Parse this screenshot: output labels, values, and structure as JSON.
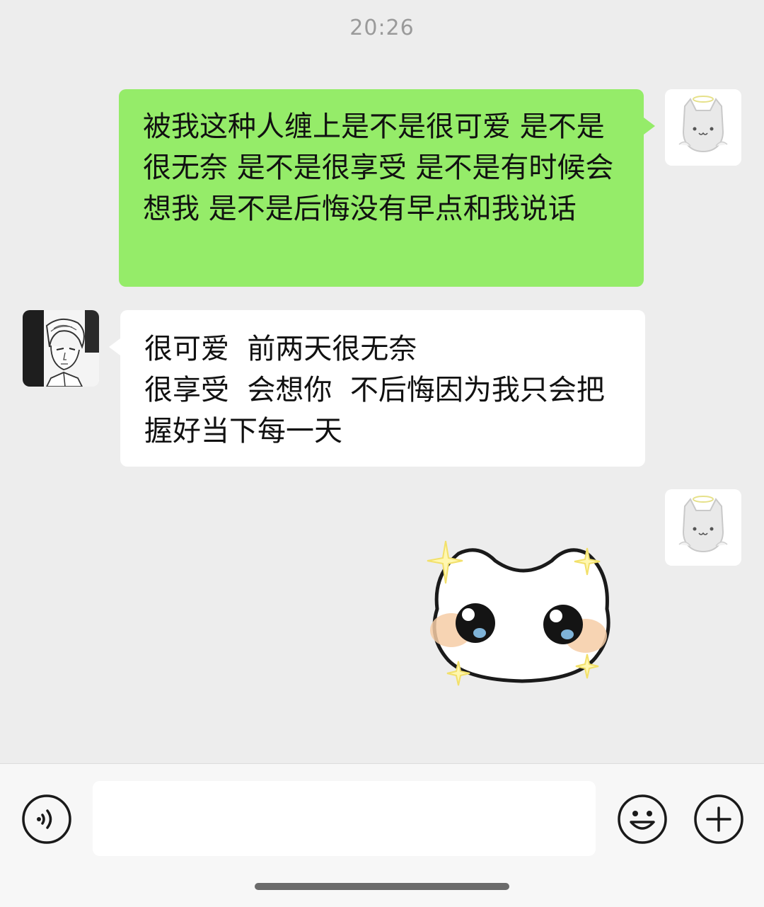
{
  "chat": {
    "timestamp": "20:26",
    "messages": [
      {
        "direction": "sent",
        "text": "被我这种人缠上是不是很可爱 是不是很无奈 是不是很享受 是不是有时候会想我 是不是后悔没有早点和我说话"
      },
      {
        "direction": "received",
        "text": "很可爱  前两天很无奈\n很享受  会想你  不后悔因为我只会把握好当下每一天"
      },
      {
        "direction": "sent",
        "type": "sticker",
        "sticker": "sparkly-cat-face-sticker"
      }
    ]
  },
  "input_bar": {
    "text_value": "",
    "voice_icon": "voice-icon",
    "emoji_icon": "emoji-icon",
    "plus_icon": "plus-icon"
  },
  "colors": {
    "background": "#EDEDED",
    "sent_bubble": "#95EC69",
    "received_bubble": "#FFFFFF",
    "input_bar": "#F7F7F7"
  }
}
